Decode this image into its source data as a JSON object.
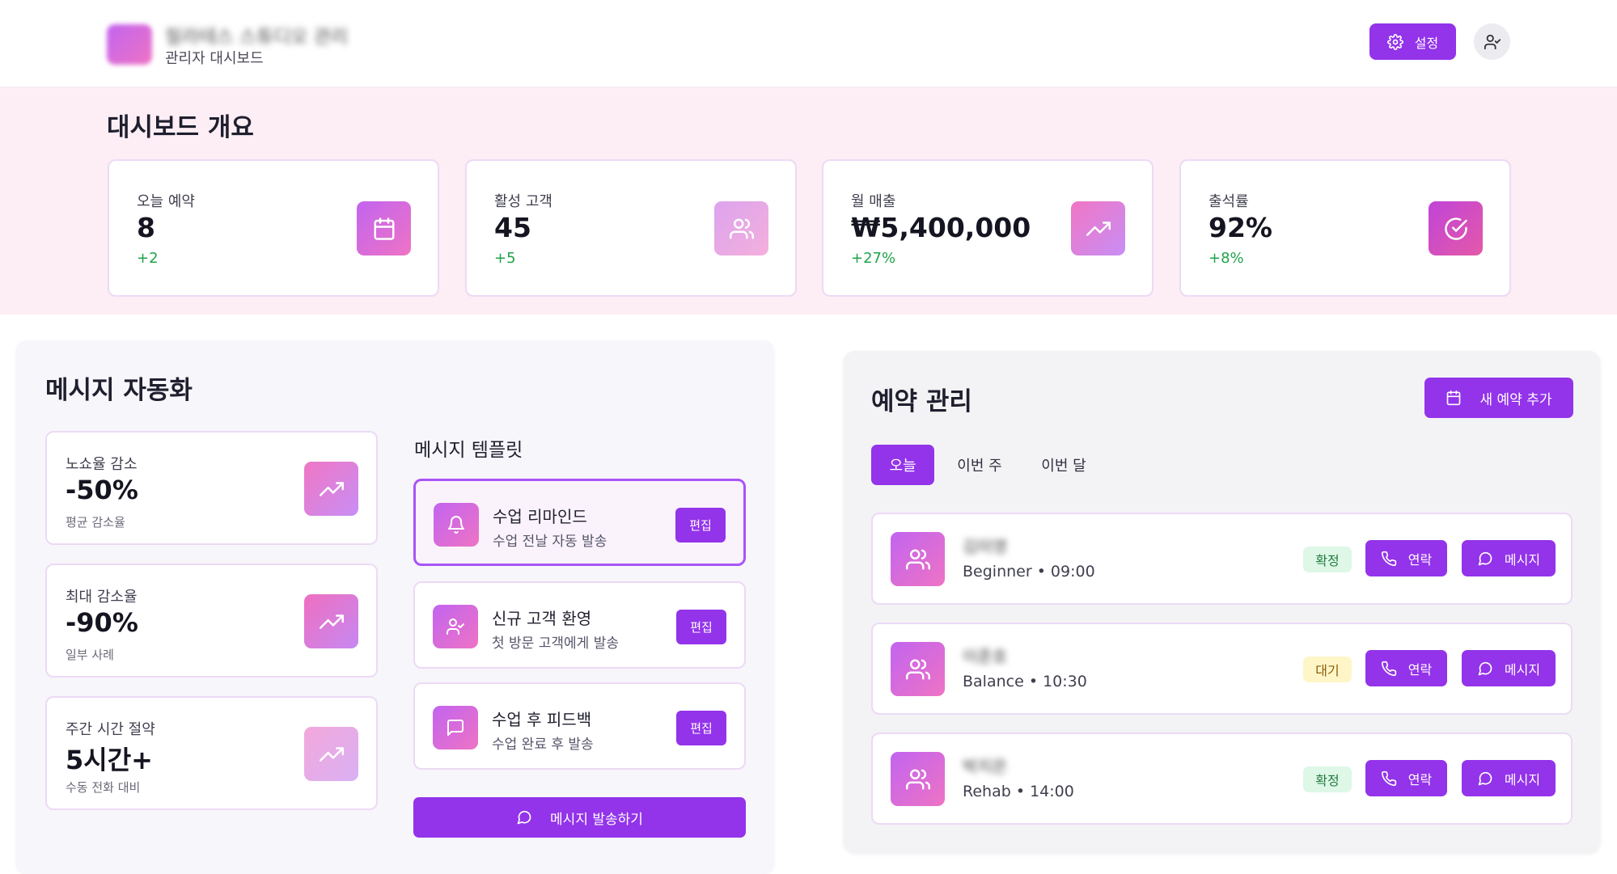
{
  "header": {
    "brand_title": "필라테스 스튜디오 관리",
    "brand_subtitle": "관리자 대시보드",
    "settings_label": "설정"
  },
  "overview": {
    "title": "대시보드 개요",
    "stats": [
      {
        "label": "오늘 예약",
        "value": "8",
        "change": "+2",
        "icon": "calendar-icon"
      },
      {
        "label": "활성 고객",
        "value": "45",
        "change": "+5",
        "icon": "users-icon"
      },
      {
        "label": "월 매출",
        "value": "₩5,400,000",
        "change": "+27%",
        "icon": "trending-up-icon"
      },
      {
        "label": "출석률",
        "value": "92%",
        "change": "+8%",
        "icon": "check-circle-icon"
      }
    ]
  },
  "automation": {
    "title": "메시지 자동화",
    "stats": [
      {
        "label": "노쇼율 감소",
        "value": "-50%",
        "sub": "평균 감소율"
      },
      {
        "label": "최대 감소율",
        "value": "-90%",
        "sub": "일부 사례"
      },
      {
        "label": "주간 시간 절약",
        "value": "5시간+",
        "sub": "수동 전화 대비"
      }
    ],
    "templates_title": "메시지 템플릿",
    "templates": [
      {
        "title": "수업 리마인드",
        "desc": "수업 전날 자동 발송",
        "edit": "편집",
        "icon": "bell-icon"
      },
      {
        "title": "신규 고객 환영",
        "desc": "첫 방문 고객에게 발송",
        "edit": "편집",
        "icon": "user-check-icon"
      },
      {
        "title": "수업 후 피드백",
        "desc": "수업 완료 후 발송",
        "edit": "편집",
        "icon": "message-square-icon"
      }
    ],
    "send_label": "메시지 발송하기"
  },
  "reservations": {
    "title": "예약 관리",
    "new_label": "새 예약 추가",
    "tabs": [
      "오늘",
      "이번 주",
      "이번 달"
    ],
    "active_tab": "오늘",
    "items": [
      {
        "name": "김미영",
        "class_time": "Beginner • 09:00",
        "status": "확정",
        "call": "연락",
        "message": "메시지"
      },
      {
        "name": "이준호",
        "class_time": "Balance • 10:30",
        "status": "대기",
        "call": "연락",
        "message": "메시지"
      },
      {
        "name": "박지은",
        "class_time": "Rehab • 14:00",
        "status": "확정",
        "call": "연락",
        "message": "메시지"
      }
    ]
  },
  "colors": {
    "accent": "#9333ea",
    "band_bg": "#fdeef5",
    "positive": "#1fa34a"
  }
}
